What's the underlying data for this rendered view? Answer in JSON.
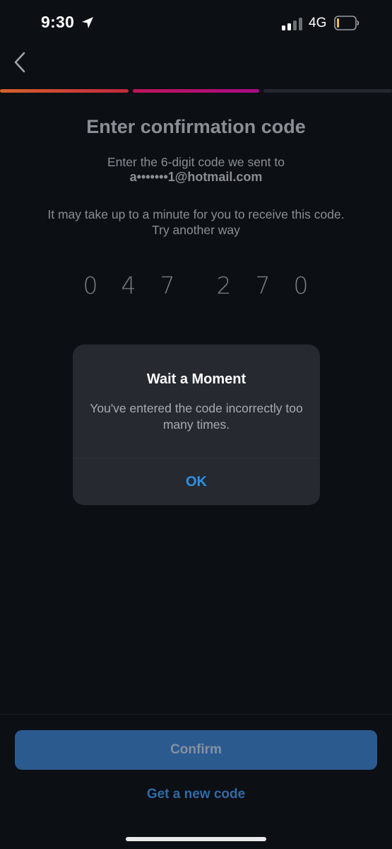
{
  "status_bar": {
    "time": "9:30",
    "network": "4G",
    "location_icon": "location-arrow-icon",
    "signal_icon": "cellular-signal-icon",
    "battery_icon": "battery-low-icon"
  },
  "nav": {
    "back_icon": "chevron-left-icon"
  },
  "progress": {
    "total_steps": 3,
    "completed_steps": 2
  },
  "content": {
    "title": "Enter confirmation code",
    "subtitle": "Enter the 6-digit code we sent to",
    "email": "a•••••••1@hotmail.com",
    "note": "It may take up to a minute for you to receive this code.",
    "alternate_link": "Try another way",
    "code_digits": [
      "0",
      "4",
      "7",
      "2",
      "7",
      "0"
    ]
  },
  "alert": {
    "title": "Wait a Moment",
    "message": "You've entered the code incorrectly too many times.",
    "ok_label": "OK"
  },
  "footer": {
    "confirm_label": "Confirm",
    "new_code_label": "Get a new code"
  },
  "colors": {
    "background": "#0c0f14",
    "accent_blue": "#2e8fe6",
    "button_blue": "#2b5a8f",
    "progress_orange": "#d4622a",
    "progress_magenta": "#a80c86"
  }
}
